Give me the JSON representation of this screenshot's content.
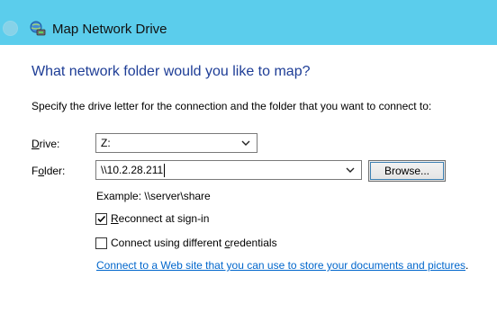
{
  "window": {
    "title": "Map Network Drive",
    "title_bar_color": "#5bcdec"
  },
  "icons": {
    "back": "back-arrow-icon",
    "app": "network-drive-icon",
    "dropdown": "chevron-down-icon",
    "check": "checkmark-icon"
  },
  "main": {
    "heading": "What network folder would you like to map?",
    "instruction": "Specify the drive letter for the connection and the folder that you want to connect to:",
    "drive": {
      "label_prefix": "",
      "label_access": "D",
      "label_rest": "rive:",
      "selected": "Z:"
    },
    "folder": {
      "label_prefix": "F",
      "label_access": "o",
      "label_rest": "lder:",
      "value": "\\\\10.2.28.211",
      "browse_label": "Browse..."
    },
    "example": "Example: \\\\server\\share",
    "reconnect": {
      "checked": true,
      "label_access": "R",
      "label_rest": "econnect at sign-in"
    },
    "credentials": {
      "checked": false,
      "label_start": "Connect using different ",
      "label_access": "c",
      "label_rest": "redentials"
    },
    "link_text": "Connect to a Web site that you can use to store your documents and pictures",
    "link_suffix": "."
  }
}
